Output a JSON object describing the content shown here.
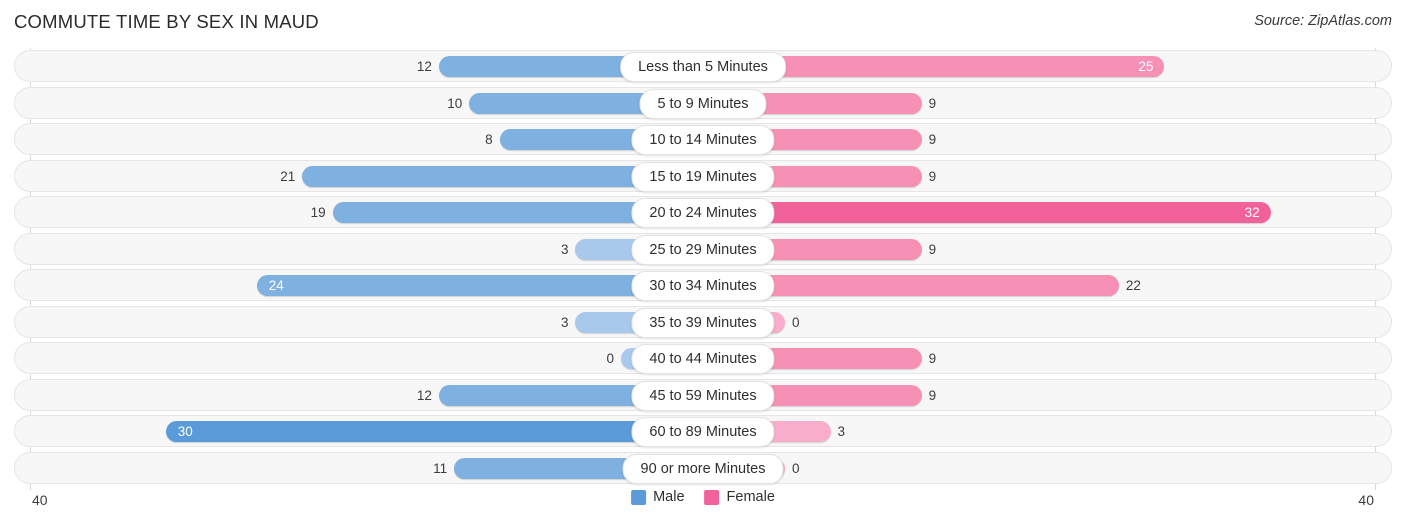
{
  "header": {
    "title": "COMMUTE TIME BY SEX IN MAUD",
    "source": "Source: ZipAtlas.com"
  },
  "axis": {
    "left_label": "40",
    "right_label": "40"
  },
  "legend": {
    "items": [
      {
        "label": "Male",
        "color": "#5b9bd9",
        "swatch": "male-swatch"
      },
      {
        "label": "Female",
        "color": "#f2629a",
        "swatch": "female-swatch"
      }
    ]
  },
  "chart_data": {
    "type": "bar",
    "orientation": "horizontal-diverging",
    "title": "COMMUTE TIME BY SEX IN MAUD",
    "xlabel": "",
    "ylabel": "",
    "xlim": [
      40,
      40
    ],
    "axis_max": 40,
    "grid": false,
    "legend_position": "bottom-center",
    "categories": [
      "Less than 5 Minutes",
      "5 to 9 Minutes",
      "10 to 14 Minutes",
      "15 to 19 Minutes",
      "20 to 24 Minutes",
      "25 to 29 Minutes",
      "30 to 34 Minutes",
      "35 to 39 Minutes",
      "40 to 44 Minutes",
      "45 to 59 Minutes",
      "60 to 89 Minutes",
      "90 or more Minutes"
    ],
    "series": [
      {
        "name": "Male",
        "color": "#5b9bd9",
        "side": "left",
        "values": [
          12,
          10,
          8,
          21,
          19,
          3,
          24,
          3,
          0,
          12,
          30,
          11
        ]
      },
      {
        "name": "Female",
        "color": "#f2629a",
        "side": "right",
        "values": [
          25,
          9,
          9,
          9,
          32,
          9,
          22,
          0,
          9,
          9,
          3,
          0
        ]
      }
    ]
  },
  "rows": [
    {
      "category": "Less than 5 Minutes",
      "male": "12",
      "female": "25"
    },
    {
      "category": "5 to 9 Minutes",
      "male": "10",
      "female": "9"
    },
    {
      "category": "10 to 14 Minutes",
      "male": "8",
      "female": "9"
    },
    {
      "category": "15 to 19 Minutes",
      "male": "21",
      "female": "9"
    },
    {
      "category": "20 to 24 Minutes",
      "male": "19",
      "female": "32"
    },
    {
      "category": "25 to 29 Minutes",
      "male": "3",
      "female": "9"
    },
    {
      "category": "30 to 34 Minutes",
      "male": "24",
      "female": "22"
    },
    {
      "category": "35 to 39 Minutes",
      "male": "3",
      "female": "0"
    },
    {
      "category": "40 to 44 Minutes",
      "male": "0",
      "female": "9"
    },
    {
      "category": "45 to 59 Minutes",
      "male": "12",
      "female": "9"
    },
    {
      "category": "60 to 89 Minutes",
      "male": "30",
      "female": "3"
    },
    {
      "category": "90 or more Minutes",
      "male": "11",
      "female": "0"
    }
  ]
}
